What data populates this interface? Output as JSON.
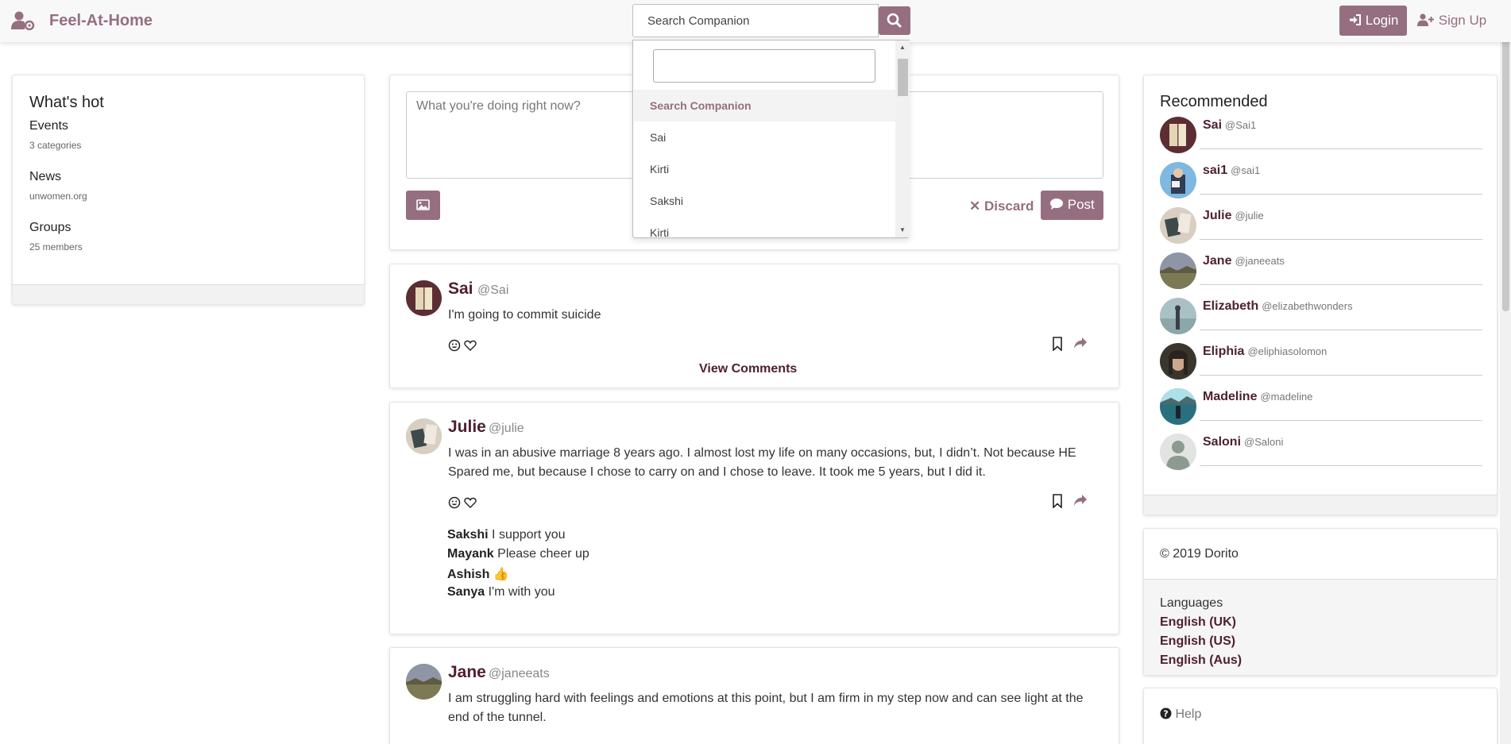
{
  "header": {
    "brand": "Feel-At-Home",
    "search_value": "Search Companion",
    "login_label": "Login",
    "signup_label": "Sign Up"
  },
  "search_dropdown": {
    "group_label": "Search Companion",
    "options": [
      "Sai",
      "Kirti",
      "Sakshi",
      "Kirti"
    ]
  },
  "whats_hot": {
    "title": "What's hot",
    "items": [
      {
        "title": "Events",
        "sub": "3 categories"
      },
      {
        "title": "News",
        "sub": "unwomen.org"
      },
      {
        "title": "Groups",
        "sub": "25 members"
      }
    ]
  },
  "compose": {
    "placeholder": "What you're doing right now?",
    "discard_label": "Discard",
    "post_label": "Post"
  },
  "posts": [
    {
      "name": "Sai",
      "handle": "@Sai",
      "text": "I'm going to commit suicide",
      "view_comments": "View Comments"
    },
    {
      "name": "Julie",
      "handle": "@julie",
      "text": "I was in an abusive marriage 8 years ago. I almost lost my life on many occasions, but, I didn’t. Not because HE Spared me, but because I chose to carry on and I chose to leave. It took me 5 years, but I did it.",
      "comments": [
        {
          "author": "Sakshi",
          "text": "I support you"
        },
        {
          "author": "Mayank",
          "text": "Please cheer up"
        },
        {
          "author": "Ashish",
          "text": "👍"
        },
        {
          "author": "Sanya",
          "text": "I'm with you"
        }
      ]
    },
    {
      "name": "Jane",
      "handle": "@janeeats",
      "text": "I am struggling hard with feelings and emotions at this point, but I am firm in my step now and can see light at the end of the tunnel."
    }
  ],
  "recommended": {
    "title": "Recommended",
    "users": [
      {
        "name": "Sai",
        "handle": "@Sai1"
      },
      {
        "name": "sai1",
        "handle": "@sai1"
      },
      {
        "name": "Julie",
        "handle": "@julie"
      },
      {
        "name": "Jane",
        "handle": "@janeeats"
      },
      {
        "name": "Elizabeth",
        "handle": "@elizabethwonders"
      },
      {
        "name": "Eliphia",
        "handle": "@eliphiasolomon"
      },
      {
        "name": "Madeline",
        "handle": "@madeline"
      },
      {
        "name": "Saloni",
        "handle": "@Saloni"
      }
    ]
  },
  "footer": {
    "copyright": "© 2019 Dorito",
    "languages_title": "Languages",
    "languages": [
      "English (UK)",
      "English (US)",
      "English (Aus)"
    ],
    "help_label": "Help"
  },
  "colors": {
    "accent": "#956f80",
    "name": "#4e2030"
  }
}
